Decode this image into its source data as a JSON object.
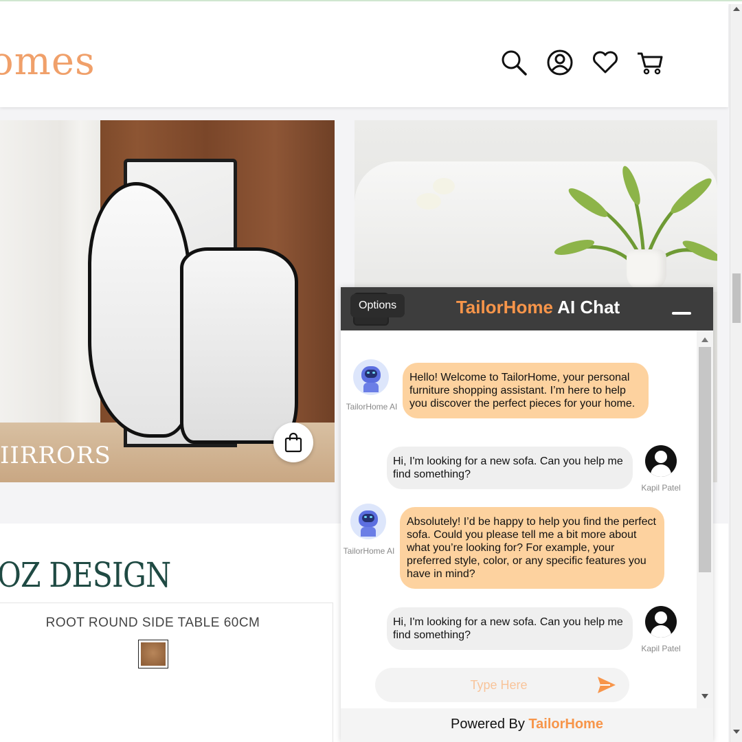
{
  "header": {
    "logo_text": "omes",
    "icons": [
      "search-icon",
      "account-icon",
      "wishlist-heart-icon",
      "cart-icon"
    ]
  },
  "hero": {
    "left_caption": "IIRRORS"
  },
  "brand_section": {
    "title": "OZ DESIGN",
    "product_name": "ROOT ROUND SIDE TABLE 60CM"
  },
  "chat": {
    "title_brand": "TailorHome",
    "title_rest": " AI Chat",
    "options_tooltip": "Options",
    "messages": [
      {
        "sender": "TailorHome AI",
        "role": "bot",
        "text": "Hello! Welcome to TailorHome, your personal furniture shopping assistant. I’m here to help you discover the perfect pieces for your home."
      },
      {
        "sender": "Kapil Patel",
        "role": "user",
        "text": "Hi, I'm looking for a new sofa. Can you help me find something?"
      },
      {
        "sender": "TailorHome AI",
        "role": "bot",
        "text": "Absolutely! I’d be happy to help you find the perfect sofa. Could you please tell me a bit more about what you’re looking for? For example, your preferred style, color, or any specific features you have in mind?"
      },
      {
        "sender": "Kapil Patel",
        "role": "user",
        "text": "Hi, I'm looking for a new sofa. Can you help me find something?"
      }
    ],
    "input_placeholder": "Type Here",
    "footer_prefix": "Powered By ",
    "footer_brand": "TailorHome"
  },
  "colors": {
    "brand_orange": "#f7954a",
    "bot_bubble": "#fdd29f",
    "user_bubble": "#efefef",
    "chat_header": "#3d3d3d",
    "brand_green": "#1f4a43"
  }
}
